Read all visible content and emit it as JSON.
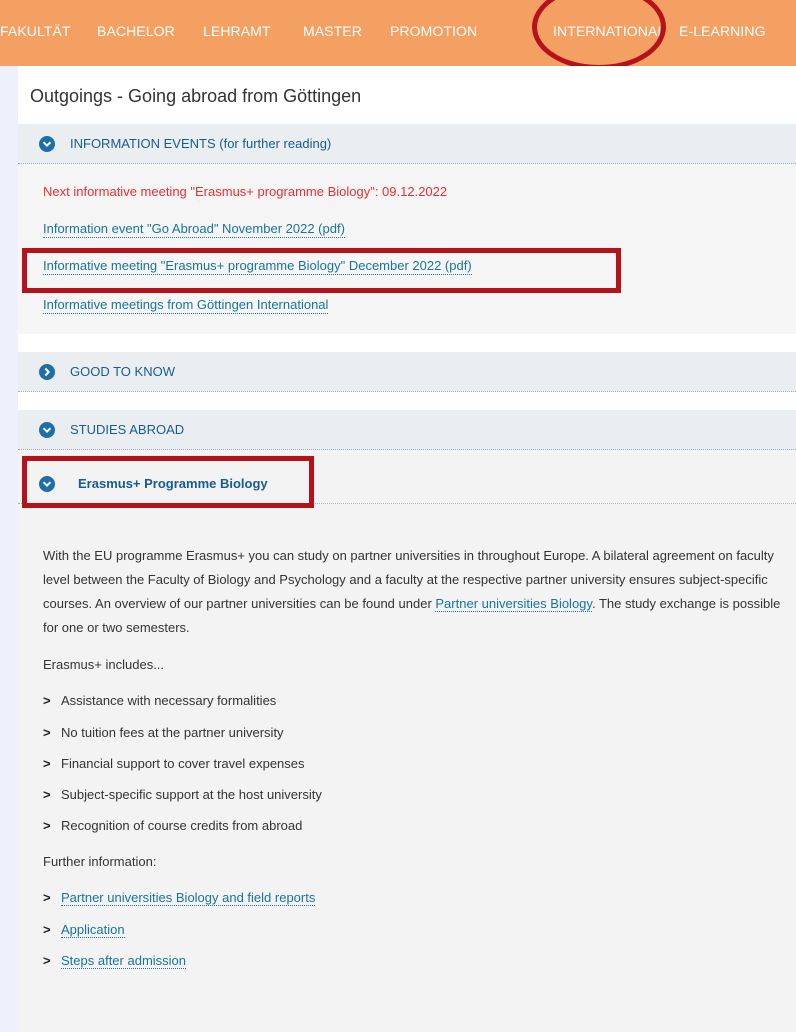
{
  "nav": {
    "items": [
      "FAKULTÄT",
      "BACHELOR",
      "LEHRAMT",
      "MASTER",
      "PROMOTION",
      "INTERNATIONAL",
      "E-LEARNING"
    ]
  },
  "page_title": "Outgoings - Going abroad from Göttingen",
  "sections": {
    "info_events": {
      "label": "INFORMATION EVENTS (for further reading)",
      "announcement": "Next informative meeting \"Erasmus+ programme Biology\": 09.12.2022",
      "links": [
        "Information event \"Go Abroad\" November 2022 (pdf)",
        "Informative meeting \"Erasmus+ programme Biology\" December 2022 (pdf)",
        "Informative meetings from Göttingen International"
      ]
    },
    "good_to_know": {
      "label": "GOOD TO KNOW"
    },
    "studies_abroad": {
      "label": "STUDIES ABROAD"
    },
    "erasmus": {
      "label": "Erasmus+ Programme Biology",
      "paragraph_before": "With the EU programme Erasmus+ you can study on partner universities in throughout Europe. A bilateral agreement on faculty level between the Faculty of Biology and Psychology and a faculty at the respective partner university ensures subject-specific courses. An overview of our partner universities can be found under ",
      "paragraph_link": "Partner universities Biology",
      "paragraph_after": ". The study exchange is possible for one or two semesters.",
      "includes_label": "Erasmus+ includes...",
      "includes": [
        "Assistance with necessary formalities",
        "No tuition fees at the partner university",
        "Financial support to cover travel expenses",
        "Subject-specific support at the host university",
        "Recognition of course credits from abroad"
      ],
      "further_label": "Further information:",
      "further_links": [
        "Partner universities Biology and field reports",
        "Application",
        "Steps after admission"
      ]
    }
  },
  "colors": {
    "nav_bg": "#f4a063",
    "highlight": "#b5121b",
    "link": "#18749b",
    "accordion_icon": "#1d6fa8",
    "announcement": "#e8302f"
  },
  "icons": {
    "expanded": "chevron-down-circle-icon",
    "collapsed": "chevron-right-circle-icon",
    "bullet": "chevron-right-icon"
  }
}
